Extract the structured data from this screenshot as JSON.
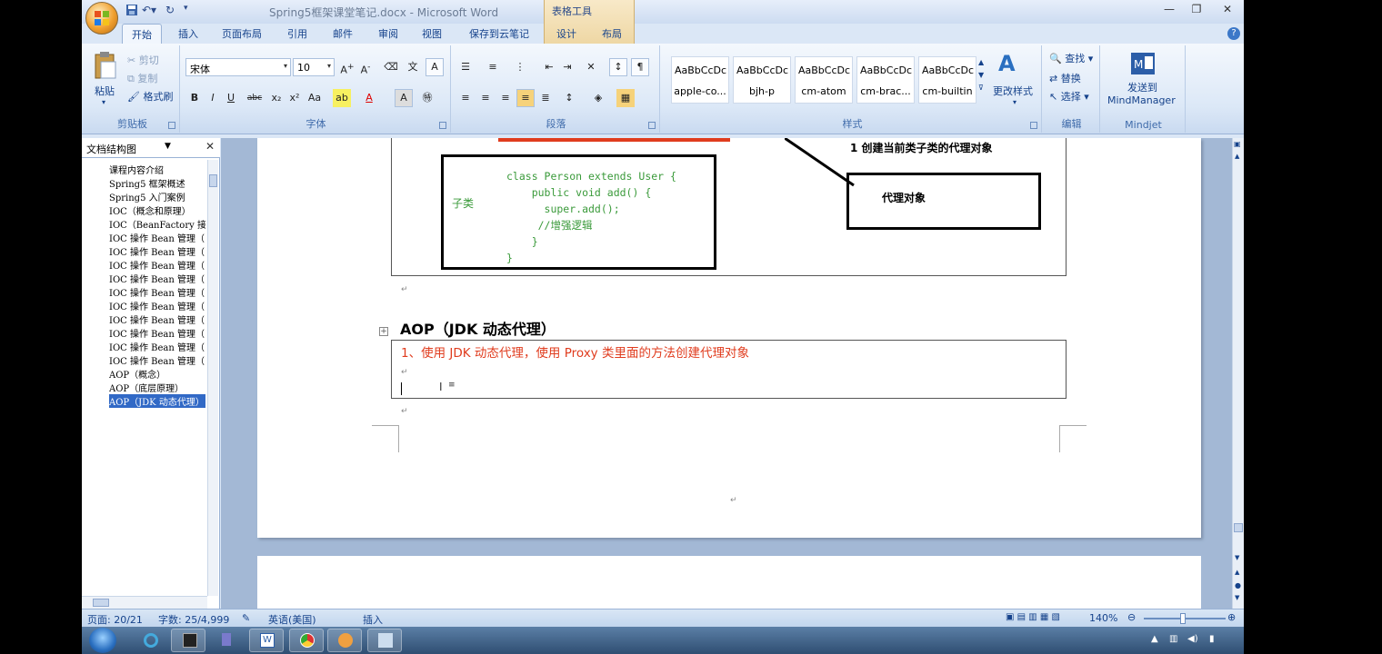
{
  "window": {
    "title": "Spring5框架课堂笔记.docx - Microsoft Word",
    "context_tools": "表格工具"
  },
  "tabs": [
    "开始",
    "插入",
    "页面布局",
    "引用",
    "邮件",
    "审阅",
    "视图",
    "保存到云笔记",
    "设计",
    "布局"
  ],
  "ribbon": {
    "clipboard": {
      "paste": "粘贴",
      "cut": "剪切",
      "copy": "复制",
      "format_painter": "格式刷",
      "label": "剪贴板"
    },
    "font": {
      "font_name": "宋体",
      "font_size": "10",
      "label": "字体"
    },
    "paragraph": {
      "label": "段落"
    },
    "styles": {
      "label": "样式",
      "tiles": [
        {
          "sample": "AaBbCcDc",
          "name": "apple-co..."
        },
        {
          "sample": "AaBbCcDc",
          "name": "bjh-p"
        },
        {
          "sample": "AaBbCcDc",
          "name": "cm-atom"
        },
        {
          "sample": "AaBbCcDc",
          "name": "cm-brac..."
        },
        {
          "sample": "AaBbCcDc",
          "name": "cm-builtin"
        }
      ],
      "change_styles": "更改样式"
    },
    "editing": {
      "find": "查找",
      "replace": "替换",
      "select": "选择",
      "label": "编辑"
    },
    "mindjet": {
      "send_line1": "发送到",
      "send_line2": "MindManager",
      "label": "Mindjet"
    }
  },
  "nav": {
    "title": "文档结构图",
    "items": [
      "课程内容介绍",
      "Spring5 框架概述",
      "Spring5 入门案例",
      "IOC（概念和原理）",
      "IOC（BeanFactory 接",
      "IOC 操作 Bean 管理（",
      "IOC 操作 Bean 管理（",
      "IOC 操作 Bean 管理（",
      "IOC 操作 Bean 管理（",
      "IOC 操作 Bean 管理（",
      "IOC 操作 Bean 管理（",
      "IOC 操作 Bean 管理（",
      "IOC 操作 Bean 管理（",
      "IOC 操作 Bean 管理（",
      "IOC 操作 Bean 管理（",
      "AOP（概念）",
      "AOP（底层原理）",
      "AOP（JDK 动态代理）"
    ],
    "selected_index": 17
  },
  "document": {
    "diagram": {
      "subclass_label": "子类",
      "code": [
        "class Person extends User {",
        "    public void add() {",
        "      super.add();",
        "     //增强逻辑",
        "    }",
        "}"
      ],
      "note": "1  创建当前类子类的代理对象",
      "proxy_box": "代理对象"
    },
    "heading": "AOP（JDK 动态代理）",
    "table_line": "1、使用 JDK 动态代理，使用 Proxy 类里面的方法创建代理对象"
  },
  "status": {
    "page": "页面: 20/21",
    "words": "字数: 25/4,999",
    "language": "英语(美国)",
    "mode": "插入",
    "zoom": "140%"
  },
  "colors": {
    "accent": "#15428b",
    "red_text": "#e03c1e",
    "code_green": "#3a9a3a",
    "selection": "#3169c6"
  }
}
